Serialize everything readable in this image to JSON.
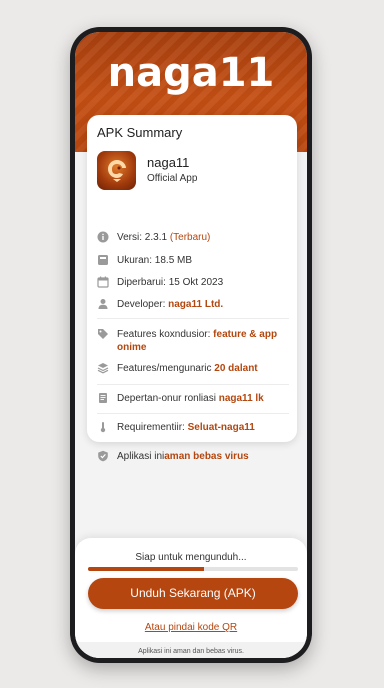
{
  "header": {
    "logo_text": "naga11"
  },
  "summary": {
    "title": "APK Summary",
    "app_name": "naga11",
    "app_subtitle": "Official App",
    "rows": [
      {
        "icon": "info-icon",
        "label": "Versi: 2.3.1 ",
        "value": "(Terbaru)"
      },
      {
        "icon": "storage-icon",
        "label": "Ukuran: 18.5 MB",
        "value": ""
      },
      {
        "icon": "calendar-icon",
        "label": "Diperbarui: 15 Okt 2023",
        "value": ""
      },
      {
        "icon": "person-icon",
        "label": "Developer: ",
        "value": "naga11 Ltd."
      },
      {
        "icon": "tag-icon",
        "label": "Features koxndusior: ",
        "value": "feature & app onime"
      },
      {
        "icon": "layers-icon",
        "label": "Features/mengunaric ",
        "value": "20 dalant"
      },
      {
        "icon": "document-icon",
        "label": "Depertan-onur ronliasi ",
        "value": "naga11 lk"
      },
      {
        "icon": "thermometer-icon",
        "label": "Requirementiir: ",
        "value": "Seluat-naga11"
      },
      {
        "icon": "shield-check-icon",
        "label": "Aplikasi ini",
        "value": "aman bebas virus"
      }
    ]
  },
  "download": {
    "status": "Siap untuk mengunduh...",
    "progress": 0.55,
    "button_label": "Unduh Sekarang (APK)",
    "qr_link": "Atau pindai kode QR",
    "footer_note": "Aplikasi ini aman dan bebas virus."
  },
  "colors": {
    "accent": "#b5460f",
    "header": "#c44f14"
  }
}
